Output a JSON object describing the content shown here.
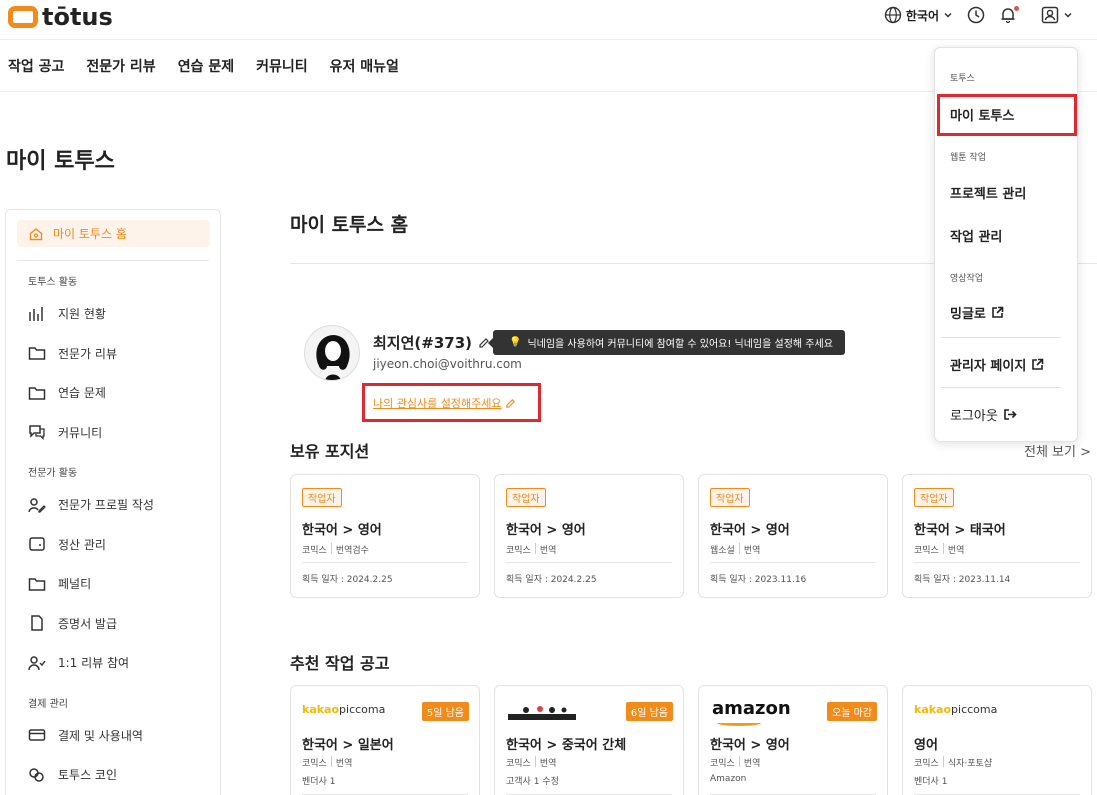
{
  "header": {
    "logo_text": "tōtus",
    "language": "한국어",
    "brand_color": "#f08b1c"
  },
  "nav": [
    "작업 공고",
    "전문가 리뷰",
    "연습 문제",
    "커뮤니티",
    "유저 매뉴얼"
  ],
  "page_title": "마이 토투스",
  "sidebar": {
    "home": "마이 토투스 홈",
    "sections": [
      {
        "title": "토투스 활동",
        "items": [
          {
            "label": "지원 현황",
            "icon": "bar-chart-icon"
          },
          {
            "label": "전문가 리뷰",
            "icon": "folder-icon"
          },
          {
            "label": "연습 문제",
            "icon": "folder-icon"
          },
          {
            "label": "커뮤니티",
            "icon": "chat-icon"
          }
        ]
      },
      {
        "title": "전문가 활동",
        "items": [
          {
            "label": "전문가 프로필 작성",
            "icon": "user-edit-icon"
          },
          {
            "label": "정산 관리",
            "icon": "wallet-icon"
          },
          {
            "label": "페널티",
            "icon": "folder-icon"
          },
          {
            "label": "증명서 발급",
            "icon": "document-icon"
          },
          {
            "label": "1:1 리뷰 참여",
            "icon": "user-check-icon"
          }
        ]
      },
      {
        "title": "결제 관리",
        "items": [
          {
            "label": "결제 및 사용내역",
            "icon": "credit-card-icon"
          },
          {
            "label": "토투스 코인",
            "icon": "coins-icon"
          }
        ]
      }
    ]
  },
  "main": {
    "title": "마이 토투스 홈",
    "profile": {
      "name": "최지연(#373)",
      "email": "jiyeon.choi@voithru.com",
      "tooltip": "닉네임을 사용하여 커뮤니티에 참여할 수 있어요!  닉네임을 설정해 주세요",
      "interest_link": "나의 관심사를 설정해주세요"
    },
    "positions_title": "보유 포지션",
    "view_all": "전체 보기 >",
    "positions": [
      {
        "role": "작업자",
        "lang": "한국어 > 영어",
        "tags": [
          "코믹스",
          "번역검수"
        ],
        "date": "획득 일자 : 2024.2.25"
      },
      {
        "role": "작업자",
        "lang": "한국어 > 영어",
        "tags": [
          "코믹스",
          "번역"
        ],
        "date": "획득 일자 : 2024.2.25"
      },
      {
        "role": "작업자",
        "lang": "한국어 > 영어",
        "tags": [
          "웹소설",
          "번역"
        ],
        "date": "획득 일자 : 2023.11.16"
      },
      {
        "role": "작업자",
        "lang": "한국어 > 태국어",
        "tags": [
          "코믹스",
          "번역"
        ],
        "date": "획득 일자 : 2023.11.14"
      }
    ],
    "recommend_title": "추천 작업 공고",
    "recommendations": [
      {
        "brand": "kakaopiccoma",
        "dday": "5일 남음",
        "lang": "한국어 > 일본어",
        "tags": [
          "코믹스",
          "번역"
        ],
        "client": "벤더사 1"
      },
      {
        "brand": "illustration",
        "dday": "6일 남음",
        "lang": "한국어 > 중국어 간체",
        "tags": [
          "코믹스",
          "번역"
        ],
        "client": "고객사 1 수정"
      },
      {
        "brand": "amazon",
        "dday": "오늘 마감",
        "lang": "한국어 > 영어",
        "tags": [
          "코믹스",
          "번역"
        ],
        "client": "Amazon"
      },
      {
        "brand": "kakaopiccoma",
        "dday": "",
        "lang": "영어",
        "tags": [
          "코믹스",
          "식자·포토샵"
        ],
        "client": "벤더사 1"
      }
    ]
  },
  "dropdown": {
    "section_totus": "토투스",
    "my_totus": "마이 토투스",
    "section_webtoon": "웹툰 작업",
    "project_manage": "프로젝트 관리",
    "task_manage": "작업 관리",
    "section_video": "영상작업",
    "minglo": "밍글로",
    "admin_page": "관리자 페이지",
    "logout": "로그아웃"
  }
}
